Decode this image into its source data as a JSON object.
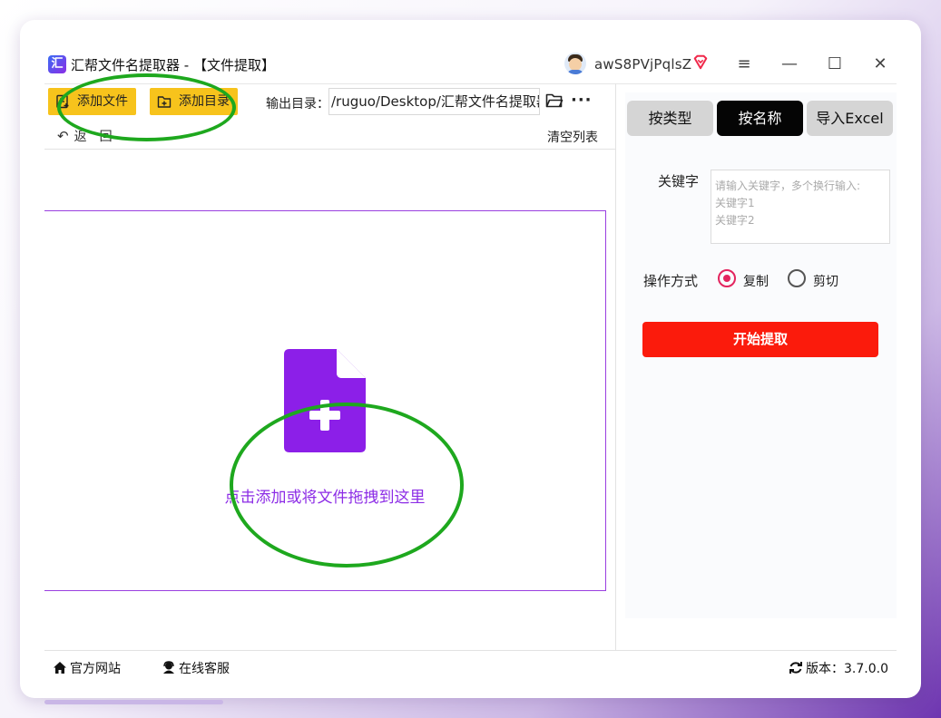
{
  "window": {
    "title": "汇帮文件名提取器 - 【文件提取】",
    "logo_text": "汇",
    "username": "awS8PVjPqlsZ",
    "controls": {
      "menu": "≡",
      "minimize": "—",
      "maximize": "☐",
      "close": "✕"
    }
  },
  "toolbar": {
    "add_file_label": "添加文件",
    "add_dir_label": "添加目录",
    "output_label": "输出目录：",
    "output_value": "/ruguo/Desktop/汇帮文件名提取器",
    "more_label": "···",
    "back_label": "返　回",
    "clear_label": "清空列表"
  },
  "drop_area": {
    "hint": "点击添加或将文件拖拽到这里"
  },
  "right_panel": {
    "tabs": [
      {
        "label": "按类型",
        "active": false
      },
      {
        "label": "按名称",
        "active": true
      },
      {
        "label": "导入Excel",
        "active": false
      }
    ],
    "keyword_label": "关键字",
    "keyword_placeholder": "请输入关键字，多个换行输入:\n关键字1\n关键字2",
    "operation_label": "操作方式",
    "options": [
      {
        "label": "复制",
        "selected": true
      },
      {
        "label": "剪切",
        "selected": false
      }
    ],
    "start_label": "开始提取"
  },
  "footer": {
    "website_label": "官方网站",
    "service_label": "在线客服",
    "version_label": "版本：3.7.0.0"
  },
  "colors": {
    "accent_purple": "#8c2ce6",
    "button_yellow": "#f7c31c",
    "start_red": "#fb1b0c",
    "active_tab": "#050505",
    "radio_selected": "#e3245e",
    "annotation_green": "#1ea81e"
  }
}
